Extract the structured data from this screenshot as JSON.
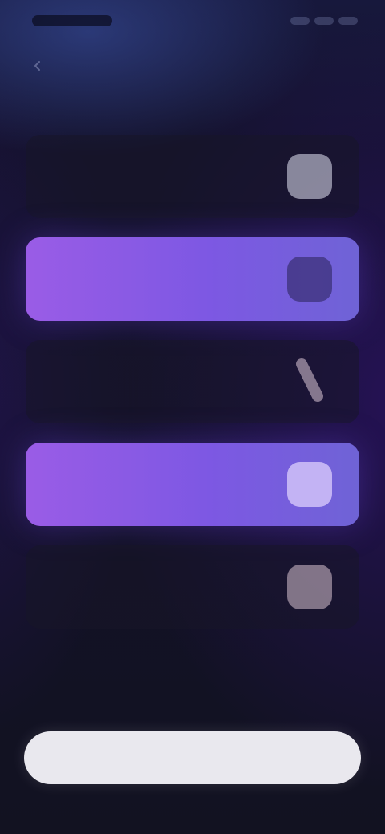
{
  "status_bar": {
    "time": "",
    "indicators": [
      "signal-icon",
      "wifi-icon",
      "battery-icon"
    ]
  },
  "header": {
    "back_icon": "chevron-left-icon",
    "title": ""
  },
  "options": [
    {
      "label": "",
      "icon": "app-icon",
      "selected": false
    },
    {
      "label": "",
      "icon": "app-icon",
      "selected": true
    },
    {
      "label": "",
      "icon": "app-icon",
      "selected": false
    },
    {
      "label": "",
      "icon": "app-icon",
      "selected": true
    },
    {
      "label": "",
      "icon": "app-icon",
      "selected": false
    }
  ],
  "footer": {
    "link_label": "",
    "primary_button_label": ""
  },
  "colors": {
    "accent_start": "#9a5ce6",
    "accent_end": "#6f63d6",
    "background": "#121126",
    "button_bg": "#e9e8ee"
  }
}
